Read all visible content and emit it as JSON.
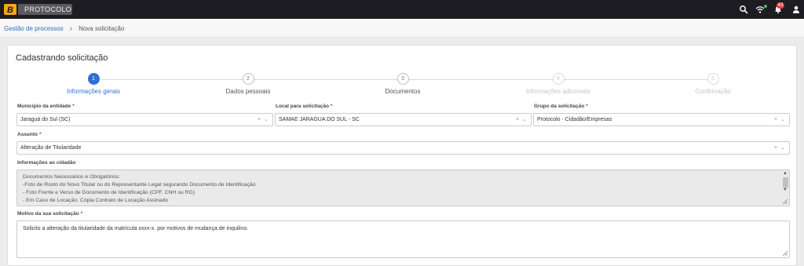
{
  "topbar": {
    "app_name": "PROTOCOLO",
    "notification_count": "43",
    "icons": [
      "search-icon",
      "wifi-icon",
      "bell-icon",
      "user-icon"
    ]
  },
  "breadcrumb": {
    "parent": "Gestão de processos",
    "separator": "›",
    "current": "Nova solicitação"
  },
  "form": {
    "title": "Cadastrando solicitação",
    "steps": [
      {
        "number": "1",
        "label": "Informações gerais",
        "state": "active"
      },
      {
        "number": "2",
        "label": "Dados pessoais",
        "state": "pending"
      },
      {
        "number": "3",
        "label": "Documentos",
        "state": "pending"
      },
      {
        "number": "4",
        "label": "Informações adicionais",
        "state": "disabled"
      },
      {
        "number": "5",
        "label": "Confirmação",
        "state": "disabled"
      }
    ],
    "municipio": {
      "label": "Município da entidade",
      "required": "*",
      "value": "Jaraguá do Sul (SC)"
    },
    "local": {
      "label": "Local para solicitação",
      "required": "*",
      "value": "SAMAE JARAGUA DO SUL - SC"
    },
    "grupo": {
      "label": "Grupo da solicitação",
      "required": "*",
      "value": "Protocolo - Cidadão/Empresas"
    },
    "assunto": {
      "label": "Assunto",
      "required": "*",
      "value": "Alteração de Titularidade"
    },
    "informacoes": {
      "label": "Informações ao cidadão",
      "lines": [
        "Documentos Necessários e Obrigatórios:",
        "-Foto de Rosto do Novo Titular ou do Representante Legal segurando Documento de Identificação",
        "- Foto Frente e Verso de Documento de Identificação (CPF, CNH ou RG)",
        "- Em Caso de Locação: Cópia Contrato de Locação Assinado"
      ]
    },
    "motivo": {
      "label": "Motivo da sua solicitação",
      "required": "*",
      "value": "Solicito a alteração da titularidade da matrícula xxxx-x. por motivos de mudança de inquilino."
    },
    "select_clear": "×",
    "select_arrow": "⌄"
  },
  "colors": {
    "topbar": "#1c1c22",
    "accent": "#2f6fd6",
    "link": "#2f6fb7",
    "required": "#d32f2f",
    "badge": "#e53935"
  }
}
